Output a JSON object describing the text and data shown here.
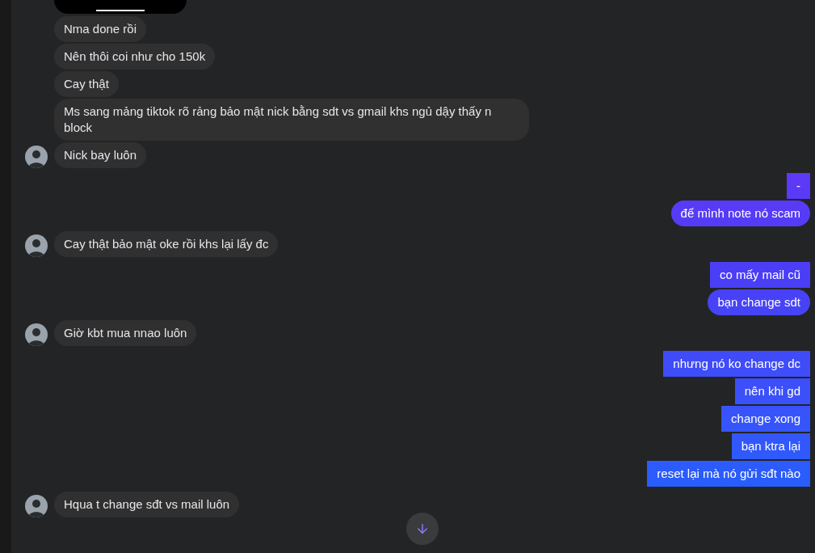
{
  "groups": [
    {
      "kind": "incoming",
      "messages": [
        {
          "text": "Nma done rồi",
          "kind": "round"
        },
        {
          "text": "Nên thôi coi như cho 150k",
          "kind": "round"
        },
        {
          "text": "Cay thật",
          "kind": "round"
        },
        {
          "text": "Ms sang mảng tiktok rõ rảng bảo mật nick bằng sdt vs gmail khs ngủ dậy thấy n block",
          "kind": "round"
        },
        {
          "text": "Nick bay luôn",
          "kind": "round"
        }
      ]
    },
    {
      "kind": "outgoing",
      "messages": [
        {
          "text": "-",
          "kind": "square"
        },
        {
          "text": "để mình note nó scam",
          "kind": "round"
        }
      ]
    },
    {
      "kind": "incoming",
      "messages": [
        {
          "text": "Cay thật bảo mật oke rồi khs lại lấy đc",
          "kind": "round"
        }
      ]
    },
    {
      "kind": "outgoing",
      "messages": [
        {
          "text": "co mấy mail cũ",
          "kind": "square"
        },
        {
          "text": "bạn change sdt",
          "kind": "round"
        }
      ]
    },
    {
      "kind": "incoming",
      "messages": [
        {
          "text": "Giờ kbt mua nnao luôn",
          "kind": "round"
        }
      ]
    },
    {
      "kind": "outgoing",
      "messages": [
        {
          "text": "nhưng nó ko change dc",
          "kind": "square"
        },
        {
          "text": "nên khi gd",
          "kind": "square"
        },
        {
          "text": "change xong",
          "kind": "square"
        },
        {
          "text": "bạn ktra lại",
          "kind": "square"
        },
        {
          "text": "reset lại mà nó gửi sđt nào",
          "kind": "square"
        }
      ]
    },
    {
      "kind": "incoming",
      "messages": [
        {
          "text": "Hqua t change sđt vs mail luôn",
          "kind": "round"
        }
      ]
    }
  ]
}
